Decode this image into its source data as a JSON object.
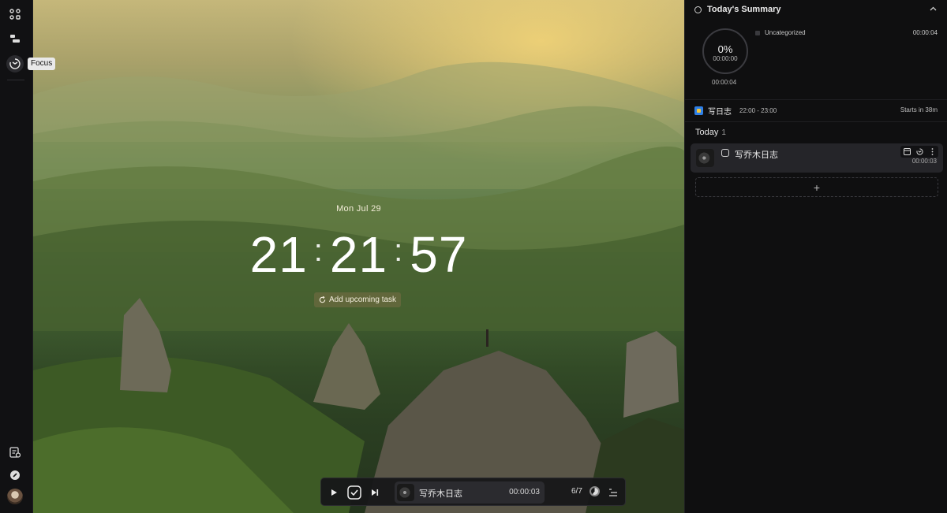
{
  "sidebar": {
    "tooltip": "Focus",
    "icons": [
      "board-icon",
      "timeline-icon",
      "focus-icon",
      "tasks-icon",
      "compass-icon",
      "avatar"
    ]
  },
  "focus": {
    "date": "Mon Jul 29",
    "clock": {
      "hours": "21",
      "minutes": "21",
      "seconds": "57",
      "separator": ":"
    },
    "add_upcoming_label": "Add upcoming task"
  },
  "player": {
    "task_name": "写乔木日志",
    "elapsed": "00:00:03",
    "session_count": "6/7",
    "session_progress": 0.6
  },
  "summary": {
    "title": "Today's Summary",
    "percent": "0%",
    "donut_time": "00:00:00",
    "total_time": "00:00:04",
    "categories": [
      {
        "name": "Uncategorized",
        "time": "00:00:04",
        "color": "#3a3a3e"
      }
    ]
  },
  "event": {
    "title": "写日志",
    "time_range": "22:00 - 23:00",
    "starts_in": "Starts in 38m"
  },
  "today": {
    "label": "Today",
    "count": "1",
    "tasks": [
      {
        "name": "写乔木日志",
        "time": "00:00:03"
      }
    ],
    "add_label": "+"
  }
}
